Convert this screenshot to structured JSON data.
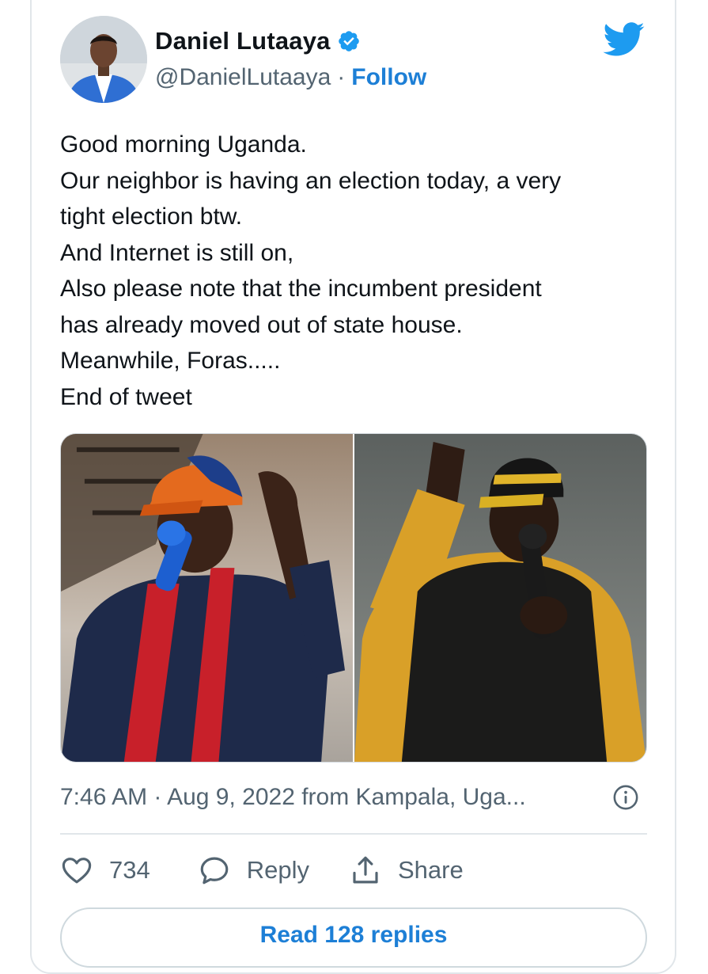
{
  "tweet": {
    "author": {
      "display_name": "Daniel Lutaaya",
      "handle": "@DanielLutaaya",
      "follow_label": "Follow",
      "verified": true
    },
    "text_lines": [
      "Good morning Uganda.",
      "Our neighbor is having an election today, a very",
      "tight election btw.",
      "And Internet is still on,",
      "Also please note that the incumbent president",
      "has already moved out of state house.",
      "Meanwhile, Foras.....",
      "End of tweet"
    ],
    "media": {
      "photo_count": 2
    },
    "meta": "7:46 AM · Aug 9, 2022 from Kampala, Uga...",
    "actions": {
      "likes": "734",
      "reply_label": "Reply",
      "share_label": "Share"
    },
    "read_replies_label": "Read 128 replies"
  },
  "colors": {
    "accent": "#1d7fd6",
    "twitter_blue": "#1d9bf0",
    "text_primary": "#0f1419",
    "text_secondary": "#536471"
  },
  "icons": {
    "brand": "twitter-bird-icon",
    "verified": "verified-badge-icon",
    "info": "info-icon",
    "like": "heart-icon",
    "reply": "speech-bubble-icon",
    "share": "share-icon"
  }
}
